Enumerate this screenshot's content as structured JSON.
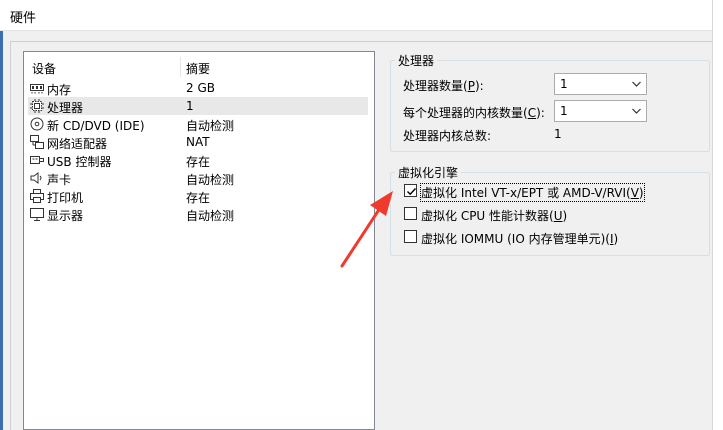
{
  "window": {
    "title": "硬件"
  },
  "devices": {
    "columns": [
      "设备",
      "摘要"
    ],
    "rows": [
      {
        "icon": "memory-icon",
        "name": "内存",
        "summary": "2 GB"
      },
      {
        "icon": "processor-icon",
        "name": "处理器",
        "summary": "1",
        "selected": true
      },
      {
        "icon": "cd-dvd-icon",
        "name": "新 CD/DVD (IDE)",
        "summary": "自动检测"
      },
      {
        "icon": "network-adapter-icon",
        "name": "网络适配器",
        "summary": "NAT"
      },
      {
        "icon": "usb-icon",
        "name": "USB 控制器",
        "summary": "存在"
      },
      {
        "icon": "sound-card-icon",
        "name": "声卡",
        "summary": "自动检测"
      },
      {
        "icon": "printer-icon",
        "name": "打印机",
        "summary": "存在"
      },
      {
        "icon": "display-icon",
        "name": "显示器",
        "summary": "自动检测"
      }
    ]
  },
  "processors": {
    "title": "处理器",
    "count_label": "处理器数量(",
    "count_hotkey": "P",
    "count_label_end": "):",
    "count_value": "1",
    "cores_label": "每个处理器的内核数量(",
    "cores_hotkey": "C",
    "cores_label_end": "):",
    "cores_value": "1",
    "total_label": "处理器内核总数:",
    "total_value": "1"
  },
  "virtualization": {
    "title": "虚拟化引擎",
    "options": [
      {
        "pre": "虚拟化 Intel VT-x/EPT 或 AMD-V/RVI(",
        "key": "V",
        "post": ")",
        "checked": true
      },
      {
        "pre": "虚拟化 CPU 性能计数器(",
        "key": "U",
        "post": ")",
        "checked": false
      },
      {
        "pre": "虚拟化 IOMMU (IO 内存管理单元)(",
        "key": "I",
        "post": ")",
        "checked": false
      }
    ]
  },
  "colors": {
    "annotation_arrow": "#ee3b2e",
    "selection": "#e8e8e8"
  }
}
